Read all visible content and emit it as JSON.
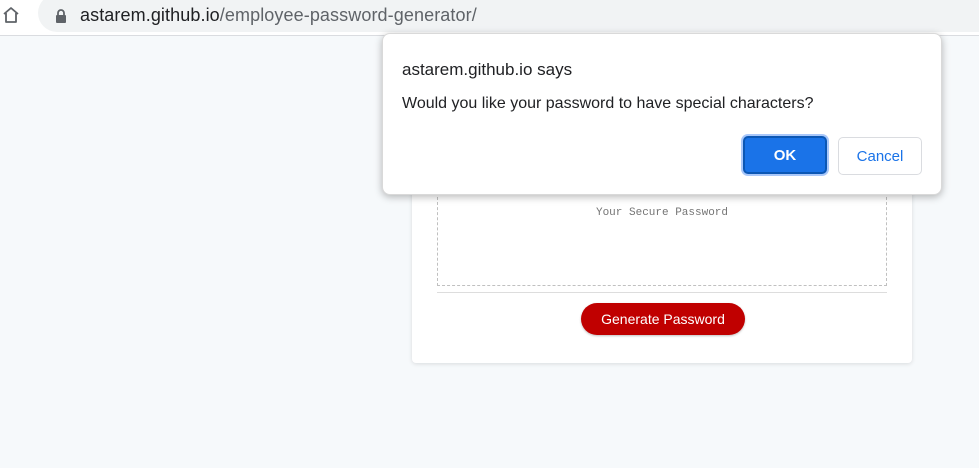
{
  "browser": {
    "url_host": "astarem.github.io",
    "url_path": "/employee-password-generator/",
    "home_icon": "home-icon",
    "lock_icon": "lock-icon"
  },
  "page": {
    "password_placeholder": "Your Secure Password",
    "generate_button_label": "Generate Password",
    "accent_color": "#c00000"
  },
  "dialog": {
    "title": "astarem.github.io says",
    "message": "Would you like your password to have special characters?",
    "ok_label": "OK",
    "cancel_label": "Cancel",
    "ok_color": "#1a73e8"
  }
}
